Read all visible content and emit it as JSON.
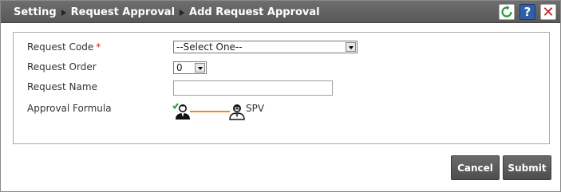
{
  "breadcrumb": {
    "items": [
      "Setting",
      "Request Approval",
      "Add Request Approval"
    ]
  },
  "toolbar": {
    "refresh_icon": "refresh-icon",
    "help_label": "?",
    "close_label": "✕",
    "colors": {
      "refresh": "#2a9a3a",
      "help": "#2f5fa8",
      "close": "#c02020"
    }
  },
  "form": {
    "request_code": {
      "label": "Request Code",
      "required_mark": "*",
      "value": "--Select One--"
    },
    "request_order": {
      "label": "Request Order",
      "value": "0"
    },
    "request_name": {
      "label": "Request Name",
      "value": ""
    },
    "approval_formula": {
      "label": "Approval Formula",
      "first_approver_icon": "requester-checked-icon",
      "second_approver_icon": "approver-icon",
      "second_approver_label": "SPV",
      "connector_color": "#f08a1e"
    }
  },
  "actions": {
    "cancel_label": "Cancel",
    "submit_label": "Submit"
  }
}
